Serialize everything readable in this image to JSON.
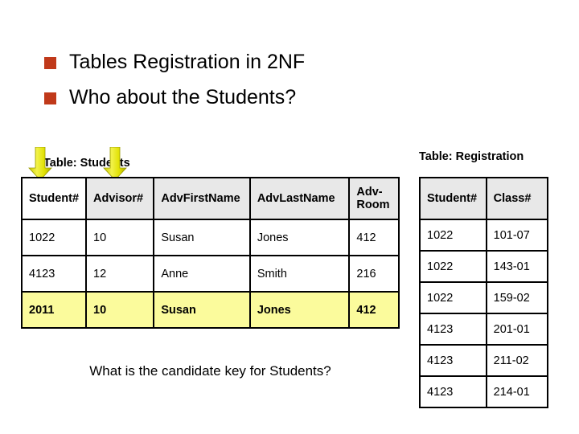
{
  "slide": {
    "bullets": [
      {
        "marker_icon": "square-bullet-icon",
        "text": "Tables Registration in 2NF"
      },
      {
        "marker_icon": "square-bullet-icon",
        "text": "Who about the Students?"
      }
    ],
    "bullet_color": "#C0391A",
    "question": "What is the candidate key for Students?"
  },
  "annotations": {
    "arrows": [
      {
        "icon": "down-arrow-icon",
        "points_to": "Student#",
        "color": "#E8E800"
      },
      {
        "icon": "down-arrow-icon",
        "points_to": "Advisor#",
        "color": "#E8E800"
      }
    ]
  },
  "students_table": {
    "caption": "Table: Students",
    "highlight_color": "#FBFB9C",
    "header_bg": "#E8E8E8",
    "columns": [
      "Student#",
      "Advisor#",
      "AdvFirstName",
      "AdvLastName",
      "Adv-Room"
    ],
    "rows": [
      {
        "cells": [
          "1022",
          "10",
          "Susan",
          "Jones",
          "412"
        ],
        "highlighted": false
      },
      {
        "cells": [
          "4123",
          "12",
          "Anne",
          "Smith",
          "216"
        ],
        "highlighted": false
      },
      {
        "cells": [
          "2011",
          "10",
          "Susan",
          "Jones",
          "412"
        ],
        "highlighted": true
      }
    ]
  },
  "registration_table": {
    "caption": "Table: Registration",
    "header_bg": "#E8E8E8",
    "columns": [
      "Student#",
      "Class#"
    ],
    "rows": [
      {
        "cells": [
          "1022",
          "101-07"
        ]
      },
      {
        "cells": [
          "1022",
          "143-01"
        ]
      },
      {
        "cells": [
          "1022",
          "159-02"
        ]
      },
      {
        "cells": [
          "4123",
          "201-01"
        ]
      },
      {
        "cells": [
          "4123",
          "211-02"
        ]
      },
      {
        "cells": [
          "4123",
          "214-01"
        ]
      }
    ]
  }
}
